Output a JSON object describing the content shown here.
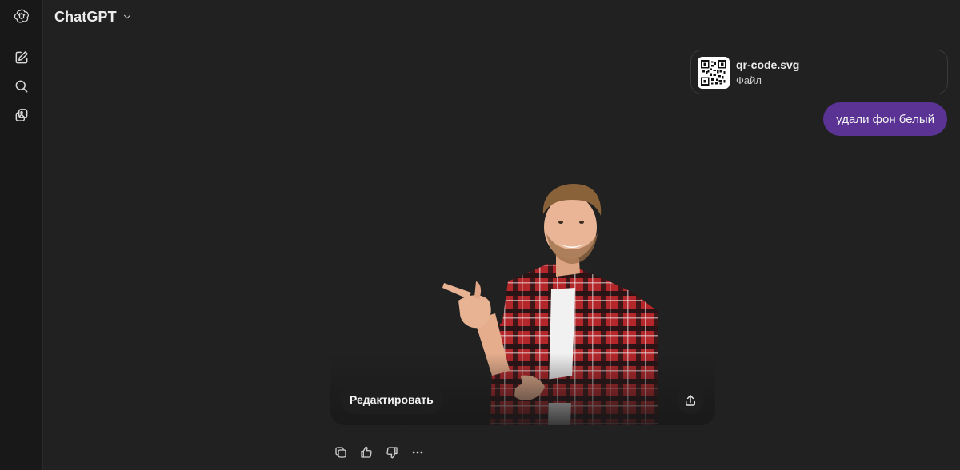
{
  "header": {
    "model_name": "ChatGPT"
  },
  "sidebar": {
    "icons": [
      "openai-logo-icon",
      "new-chat-icon",
      "search-icon",
      "library-icon"
    ]
  },
  "conversation": {
    "attachment": {
      "file_name": "qr-code.svg",
      "file_type": "Файл",
      "icon": "qr-code-icon"
    },
    "user_message": "удали фон белый",
    "image_card": {
      "edit_label": "Редактировать",
      "share_icon": "share-icon"
    },
    "actions": [
      "copy-icon",
      "thumbs-up-icon",
      "thumbs-down-icon",
      "more-icon"
    ]
  },
  "colors": {
    "background": "#212121",
    "rail": "#181818",
    "user_bubble": "#5b3394",
    "text": "#ececec"
  }
}
